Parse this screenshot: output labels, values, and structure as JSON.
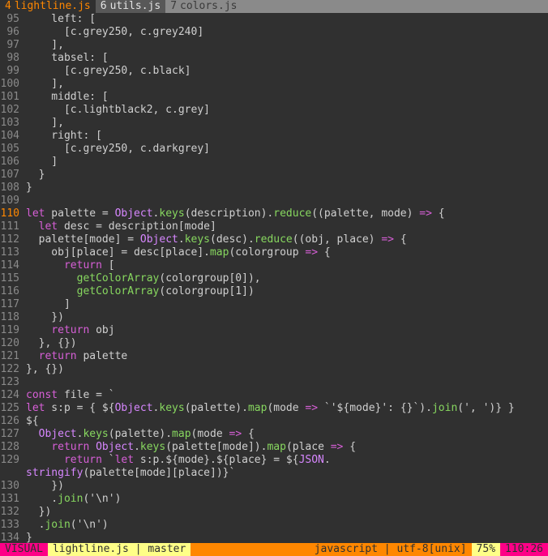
{
  "tabs": [
    {
      "num": "4",
      "label": "lightline.js",
      "state": "active"
    },
    {
      "num": "6",
      "label": "utils.js",
      "state": "inactive"
    },
    {
      "num": "7",
      "label": "colors.js",
      "state": "dim"
    }
  ],
  "lines": [
    {
      "n": "95",
      "c": "    left: ["
    },
    {
      "n": "96",
      "c": "      [c.grey250, c.grey240]"
    },
    {
      "n": "97",
      "c": "    ],"
    },
    {
      "n": "98",
      "c": "    tabsel: ["
    },
    {
      "n": "99",
      "c": "      [c.grey250, c.black]"
    },
    {
      "n": "100",
      "c": "    ],"
    },
    {
      "n": "101",
      "c": "    middle: ["
    },
    {
      "n": "102",
      "c": "      [c.lightblack2, c.grey]"
    },
    {
      "n": "103",
      "c": "    ],"
    },
    {
      "n": "104",
      "c": "    right: ["
    },
    {
      "n": "105",
      "c": "      [c.grey250, c.darkgrey]"
    },
    {
      "n": "106",
      "c": "    ]"
    },
    {
      "n": "107",
      "c": "  }"
    },
    {
      "n": "108",
      "c": "}"
    },
    {
      "n": "109",
      "c": ""
    },
    {
      "n": "110",
      "c": "let palette = Object.keys(description).reduce((palette, mode) => {",
      "cur": true
    },
    {
      "n": "111",
      "c": "  let desc = description[mode]"
    },
    {
      "n": "112",
      "c": "  palette[mode] = Object.keys(desc).reduce((obj, place) => {"
    },
    {
      "n": "113",
      "c": "    obj[place] = desc[place].map(colorgroup => {"
    },
    {
      "n": "114",
      "c": "      return ["
    },
    {
      "n": "115",
      "c": "        getColorArray(colorgroup[0]),"
    },
    {
      "n": "116",
      "c": "        getColorArray(colorgroup[1])"
    },
    {
      "n": "117",
      "c": "      ]"
    },
    {
      "n": "118",
      "c": "    })"
    },
    {
      "n": "119",
      "c": "    return obj"
    },
    {
      "n": "120",
      "c": "  }, {})"
    },
    {
      "n": "121",
      "c": "  return palette"
    },
    {
      "n": "122",
      "c": "}, {})"
    },
    {
      "n": "123",
      "c": ""
    },
    {
      "n": "124",
      "c": "const file = `"
    },
    {
      "n": "125",
      "c": "let s:p = { ${Object.keys(palette).map(mode => `'${mode}': {}`).join(', ')} }"
    },
    {
      "n": "126",
      "c": "${"
    },
    {
      "n": "127",
      "c": "  Object.keys(palette).map(mode => {"
    },
    {
      "n": "128",
      "c": "    return Object.keys(palette[mode]).map(place => {"
    },
    {
      "n": "129",
      "c": "      return `let s:p.${mode}.${place} = ${JSON."
    },
    {
      "n": "",
      "c": "stringify(palette[mode][place])}`"
    },
    {
      "n": "130",
      "c": "    })"
    },
    {
      "n": "131",
      "c": "    .join('\\n')"
    },
    {
      "n": "132",
      "c": "  })"
    },
    {
      "n": "133",
      "c": "  .join('\\n')"
    },
    {
      "n": "134",
      "c": "}"
    }
  ],
  "status": {
    "mode": "VISUAL",
    "file": "lightline.js",
    "sep": "|",
    "branch": "master",
    "filetype": "javascript",
    "encoding": "utf-8[unix]",
    "percent": "75%",
    "position": "110:26"
  },
  "colors": {
    "background": "#303030",
    "accent": "#ff8700",
    "mode_bg": "#ff0087",
    "keyword": "#d75fd7",
    "function": "#87d75f"
  }
}
